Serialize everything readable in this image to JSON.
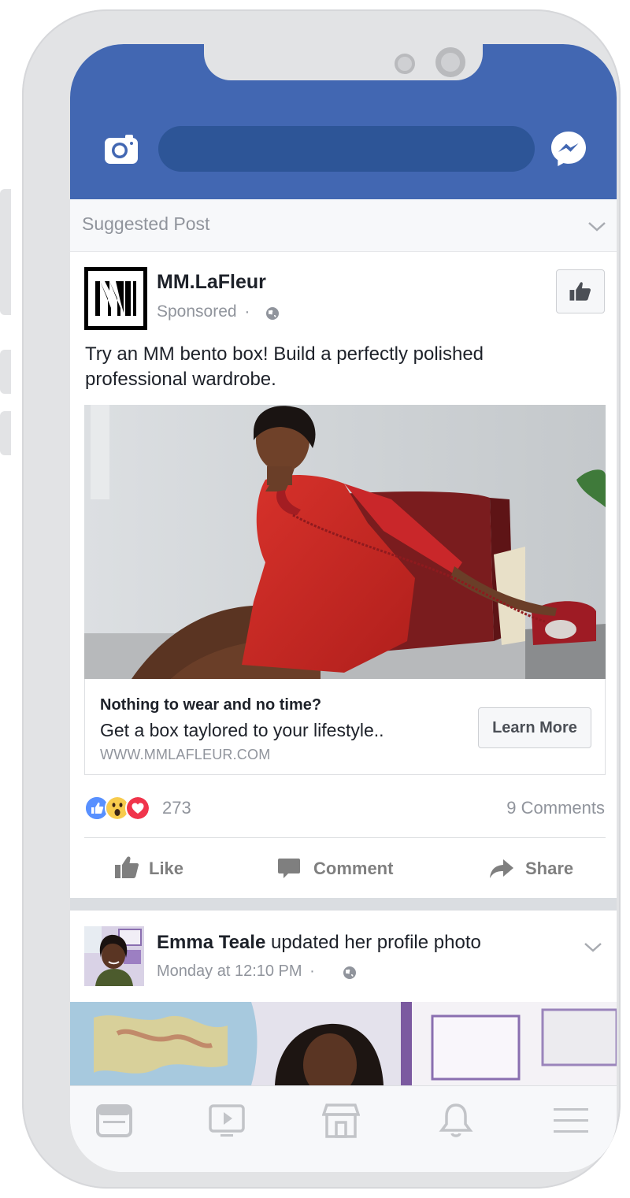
{
  "header": {
    "camera_icon": "camera-icon",
    "messenger_icon": "messenger-icon",
    "search_placeholder": ""
  },
  "suggested": {
    "label": "Suggested Post",
    "menu_icon": "chevron-down-icon"
  },
  "ad_post": {
    "page_name": "MM.LaFleur",
    "sponsored": "Sponsored",
    "separator": "·",
    "privacy_icon": "globe-icon",
    "like_page_icon": "thumbs-up-icon",
    "text": "Try an MM bento box! Build a perfectly polished professional wardrobe.",
    "image_alt": "woman in red dress talking on red rotary phone",
    "link": {
      "headline": "Nothing to wear and no time?",
      "description": "Get a box taylored to your lifestyle..",
      "url": "WWW.MMLAFLEUR.COM",
      "cta": "Learn More"
    },
    "reactions": {
      "types": [
        "like",
        "wow",
        "love"
      ],
      "count": "273",
      "comments": "9 Comments"
    },
    "actions": {
      "like": "Like",
      "comment": "Comment",
      "share": "Share"
    }
  },
  "next_post": {
    "author": "Emma Teale",
    "activity": "updated her profile photo",
    "time": "Monday at 12:10 PM",
    "separator": "·"
  },
  "nav": [
    "news-feed-icon",
    "watch-icon",
    "marketplace-icon",
    "notifications-icon",
    "menu-icon"
  ],
  "colors": {
    "brand": "#4267b2",
    "search_bar": "#2d5597",
    "secondary_text": "#90949c",
    "primary_text": "#1d2129"
  }
}
